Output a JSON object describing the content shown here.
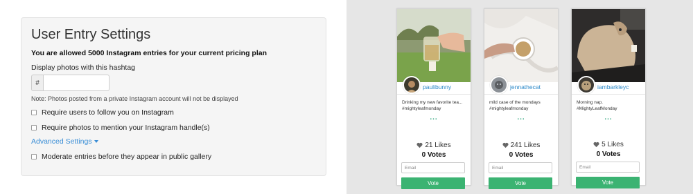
{
  "settings": {
    "title": "User Entry Settings",
    "plan_text": "You are allowed 5000 Instagram entries for your current pricing plan",
    "hashtag_label": "Display photos with this hashtag",
    "hashtag_prefix": "#",
    "hashtag_value": "",
    "note": "Note: Photos posted from a private Instagram account will not be displayed",
    "follow_label": "Require users to follow you on Instagram",
    "mention_label": "Require photos to mention your Instagram handle(s)",
    "advanced_label": "Advanced Settings",
    "moderate_label": "Moderate entries before they appear in public gallery"
  },
  "cards": [
    {
      "username": "paulibunny",
      "caption": "Drinking my new favorite tea... #mightyleafmonday",
      "dots": "...",
      "likes": "21 Likes",
      "votes": "0 Votes",
      "email_placeholder": "Email",
      "vote_label": "Vote"
    },
    {
      "username": "jennathecat",
      "caption": "mild case of the mondays #mightyleafmonday",
      "dots": "...",
      "likes": "241 Likes",
      "votes": "0 Votes",
      "email_placeholder": "Email",
      "vote_label": "Vote"
    },
    {
      "username": "iambarkleyc",
      "caption": "Morning nap. #MightyLeafMonday",
      "dots": "...",
      "likes": "5 Likes",
      "votes": "0 Votes",
      "email_placeholder": "Email",
      "vote_label": "Vote"
    }
  ],
  "colors": {
    "accent_link": "#3a8ed6",
    "vote_button": "#3bb372",
    "username": "#2a88c8"
  }
}
